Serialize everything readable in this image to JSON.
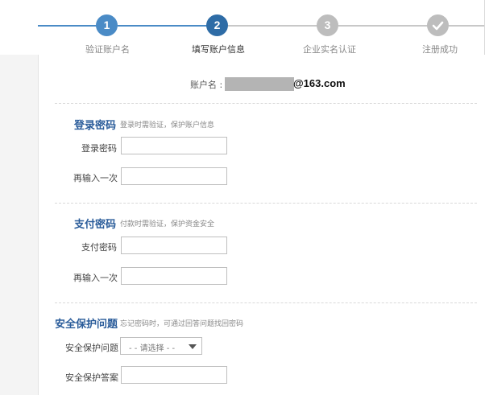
{
  "steps": [
    {
      "number": "1",
      "label": "验证账户名",
      "state": "done"
    },
    {
      "number": "2",
      "label": "填写账户信息",
      "state": "active"
    },
    {
      "number": "3",
      "label": "企业实名认证",
      "state": "pending"
    },
    {
      "number": "",
      "label": "注册成功",
      "state": "pending",
      "icon": "check-icon"
    }
  ],
  "colors": {
    "done": "#4a8bc6",
    "active": "#2e6ca6",
    "pending": "#bdbdbd",
    "section_title": "#2a5c9a"
  },
  "account": {
    "label": "账户名 :",
    "domain": "@163.com"
  },
  "login_section": {
    "title": "登录密码",
    "desc": "登录时需验证，保护账户信息",
    "password_label": "登录密码",
    "password_value": "",
    "confirm_label": "再输入一次",
    "confirm_value": ""
  },
  "pay_section": {
    "title": "支付密码",
    "desc": "付款时需验证，保护资金安全",
    "password_label": "支付密码",
    "password_value": "",
    "confirm_label": "再输入一次",
    "confirm_value": ""
  },
  "security_section": {
    "title": "安全保护问题",
    "desc": "忘记密码时，可通过回答问题找回密码",
    "question_label": "安全保护问题",
    "question_selected": "- - 请选择 - -",
    "answer_label": "安全保护答案",
    "answer_value": ""
  }
}
